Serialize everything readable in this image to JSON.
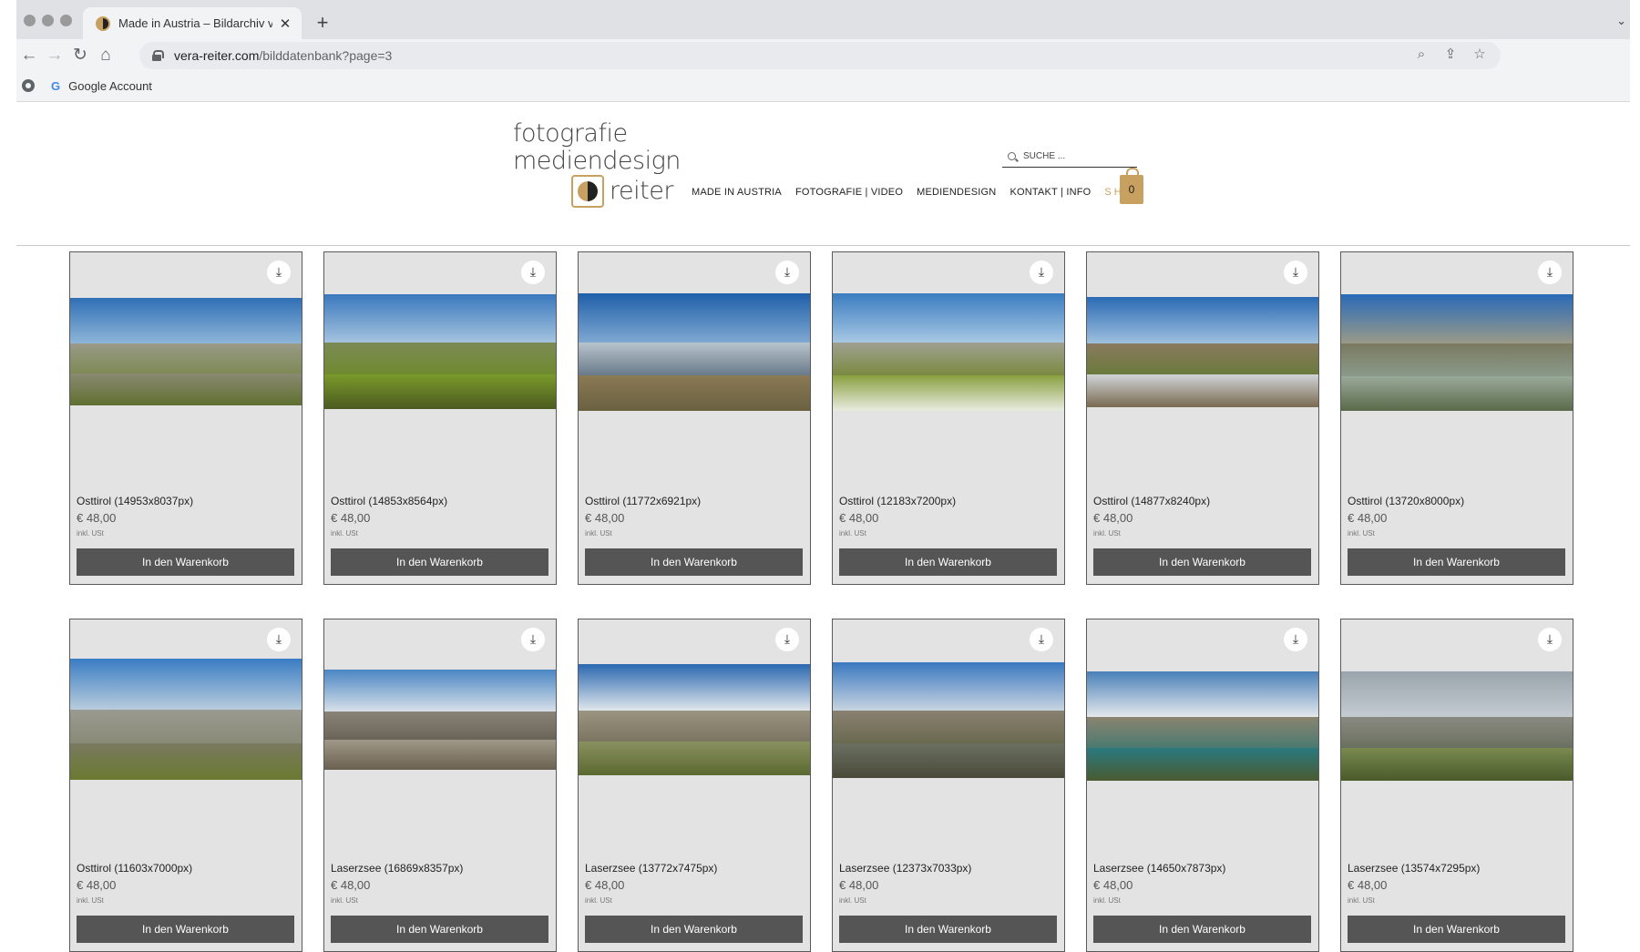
{
  "browser": {
    "tab_title": "Made in Austria – Bildarchiv vo",
    "url_host": "vera-reiter.com",
    "url_path": "/bilddatenbank?page=3",
    "bookmark_label": "Google Account"
  },
  "site": {
    "logo_lines": [
      "fotografie",
      "mediendesign",
      "reiter"
    ],
    "nav": [
      "MADE IN AUSTRIA",
      "FOTOGRAFIE | VIDEO",
      "MEDIENDESIGN",
      "KONTAKT | INFO",
      "SHOP"
    ],
    "search_placeholder": "SUCHE ...",
    "cart_count": "0",
    "accent_color": "#c8a060"
  },
  "products": [
    {
      "title": "Osttirol (14953x8037px)",
      "price": "€ 48,00",
      "tax": "inkl. USt",
      "button": "In den Warenkorb"
    },
    {
      "title": "Osttirol (14853x8564px)",
      "price": "€ 48,00",
      "tax": "inkl. USt",
      "button": "In den Warenkorb"
    },
    {
      "title": "Osttirol (11772x6921px)",
      "price": "€ 48,00",
      "tax": "inkl. USt",
      "button": "In den Warenkorb"
    },
    {
      "title": "Osttirol (12183x7200px)",
      "price": "€ 48,00",
      "tax": "inkl. USt",
      "button": "In den Warenkorb"
    },
    {
      "title": "Osttirol (14877x8240px)",
      "price": "€ 48,00",
      "tax": "inkl. USt",
      "button": "In den Warenkorb"
    },
    {
      "title": "Osttirol (13720x8000px)",
      "price": "€ 48,00",
      "tax": "inkl. USt",
      "button": "In den Warenkorb"
    },
    {
      "title": "Osttirol (11603x7000px)",
      "price": "€ 48,00",
      "tax": "inkl. USt",
      "button": "In den Warenkorb"
    },
    {
      "title": "Laserzsee (16869x8357px)",
      "price": "€ 48,00",
      "tax": "inkl. USt",
      "button": "In den Warenkorb"
    },
    {
      "title": "Laserzsee (13772x7475px)",
      "price": "€ 48,00",
      "tax": "inkl. USt",
      "button": "In den Warenkorb"
    },
    {
      "title": "Laserzsee (12373x7033px)",
      "price": "€ 48,00",
      "tax": "inkl. USt",
      "button": "In den Warenkorb"
    },
    {
      "title": "Laserzsee (14650x7873px)",
      "price": "€ 48,00",
      "tax": "inkl. USt",
      "button": "In den Warenkorb"
    },
    {
      "title": "Laserzsee (13574x7295px)",
      "price": "€ 48,00",
      "tax": "inkl. USt",
      "button": "In den Warenkorb"
    }
  ]
}
